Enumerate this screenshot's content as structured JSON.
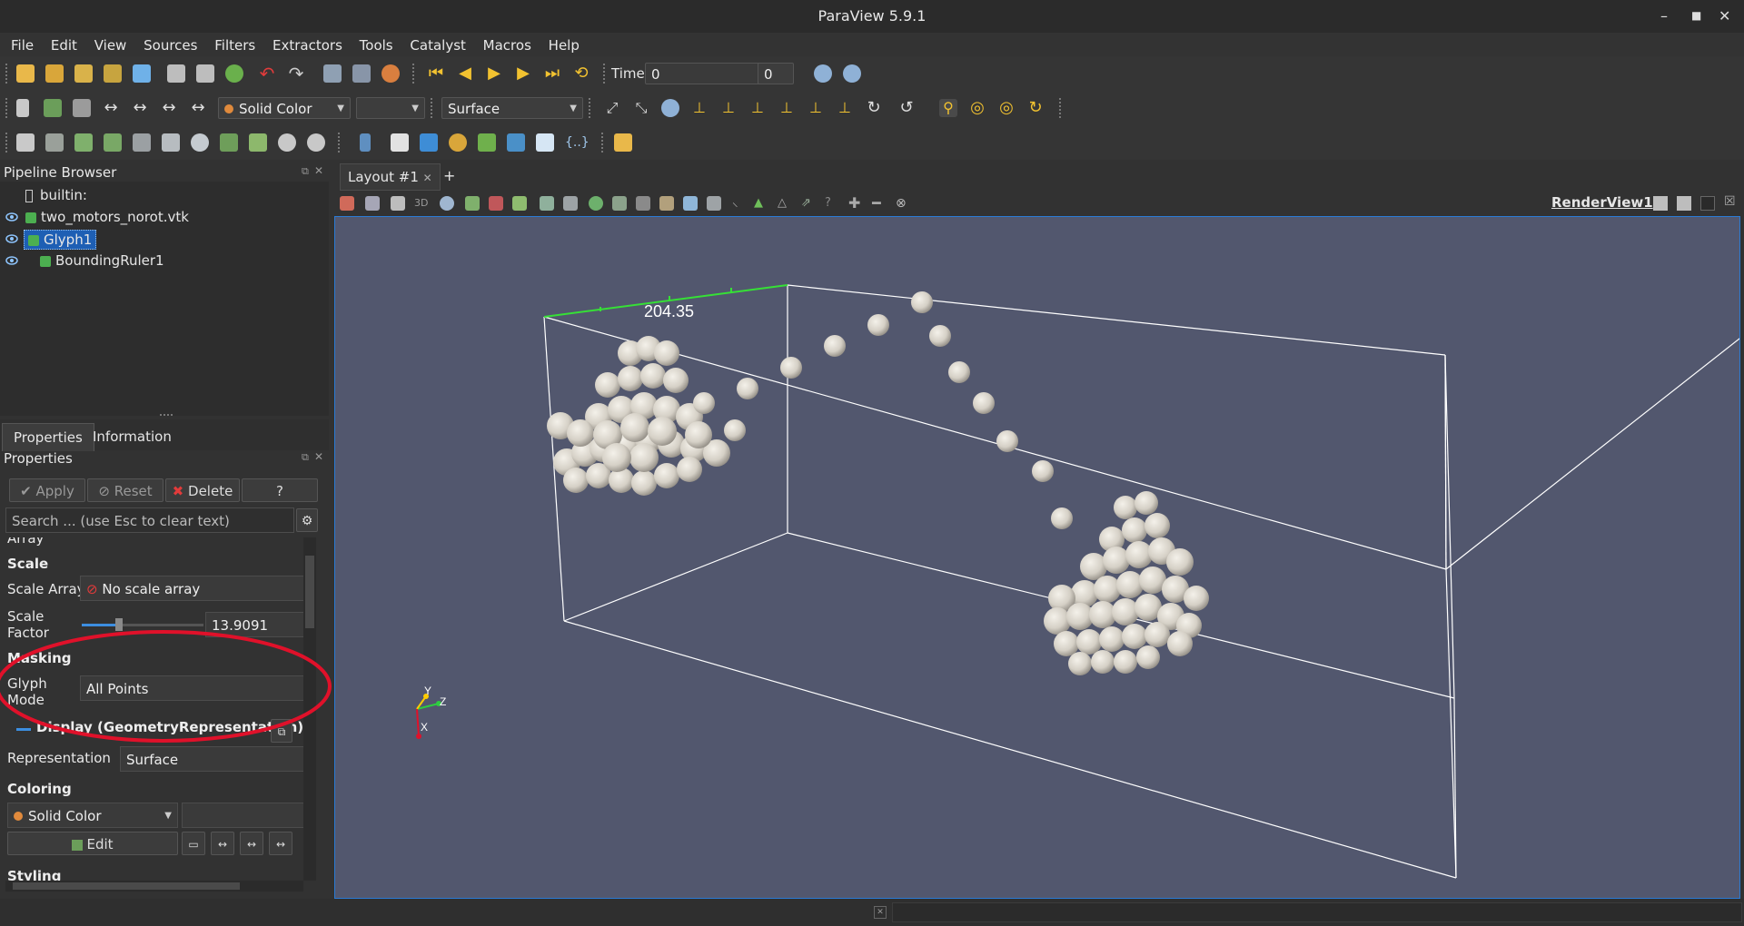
{
  "window": {
    "title": "ParaView 5.9.1"
  },
  "menu": [
    "File",
    "Edit",
    "View",
    "Sources",
    "Filters",
    "Extractors",
    "Tools",
    "Catalyst",
    "Macros",
    "Help"
  ],
  "toolbar1": {
    "time_label": "Time:",
    "time_value": "0",
    "timestep_value": "0"
  },
  "toolbar2": {
    "color_combo": "Solid Color",
    "representation_combo": "Surface"
  },
  "pipeline": {
    "title": "Pipeline Browser",
    "items": [
      {
        "label": "builtin:"
      },
      {
        "label": "two_motors_norot.vtk"
      },
      {
        "label": "Glyph1"
      },
      {
        "label": "BoundingRuler1"
      }
    ]
  },
  "tabs": {
    "properties": "Properties",
    "information": "Information"
  },
  "properties": {
    "title": "Properties",
    "apply": "Apply",
    "reset": "Reset",
    "delete": "Delete",
    "help": "?",
    "search_placeholder": "Search ... (use Esc to clear text)",
    "array_label": "Array",
    "scale_section": "Scale",
    "scale_array_label": "Scale Array",
    "scale_array_value": "No scale array",
    "scale_factor_label_1": "Scale",
    "scale_factor_label_2": "Factor",
    "scale_factor_value": "13.9091",
    "scale_factor_slider_fraction": 0.28,
    "masking_section": "Masking",
    "glyph_mode_label_1": "Glyph",
    "glyph_mode_label_2": "Mode",
    "glyph_mode_value": "All Points",
    "display_section": "Display (GeometryRepresentation)",
    "representation_label": "Representation",
    "representation_value": "Surface",
    "coloring_section": "Coloring",
    "coloring_value": "Solid Color",
    "edit_button": "Edit",
    "styling_section": "Styling"
  },
  "layout": {
    "tab": "Layout #1",
    "add_tab": "+",
    "view_name": "RenderView1"
  },
  "render": {
    "ruler_label": "204.35",
    "axes": {
      "x": "X",
      "y": "Y",
      "z": "Z"
    }
  },
  "colors": {
    "accent": "#2a7bd6",
    "background_view": "#52576e",
    "selection": "#1e5fb4",
    "annotation": "#e0112a"
  }
}
